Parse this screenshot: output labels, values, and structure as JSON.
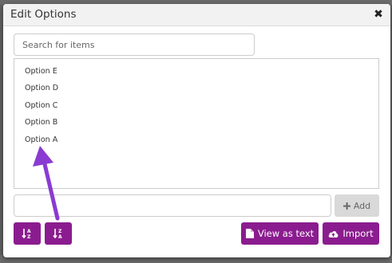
{
  "modal": {
    "title": "Edit Options",
    "close_glyph": "✖"
  },
  "search": {
    "placeholder": "Search for items"
  },
  "options": [
    {
      "label": "Option E"
    },
    {
      "label": "Option D"
    },
    {
      "label": "Option C"
    },
    {
      "label": "Option B"
    },
    {
      "label": "Option A"
    }
  ],
  "new_option": {
    "value": ""
  },
  "buttons": {
    "add_label": "Add",
    "view_as_text_label": "View as text",
    "import_label": "Import"
  },
  "icons": {
    "add": "plus-icon",
    "sort_asc": "sort-alpha-asc-icon",
    "sort_desc": "sort-alpha-desc-icon",
    "view_as_text": "file-icon",
    "import": "cloud-upload-icon"
  },
  "colors": {
    "accent": "#8b1c8f",
    "add_button_bg": "#d9d9d9",
    "annotation_arrow": "#8a3bd1",
    "overlay": "#5f5f5f"
  }
}
